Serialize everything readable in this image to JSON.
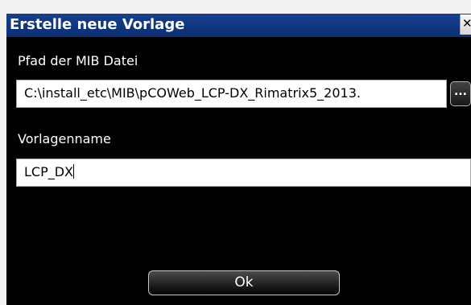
{
  "window": {
    "title": "Erstelle neue Vorlage",
    "close_icon": "close-icon",
    "close_glyph": "✕"
  },
  "form": {
    "mib_path": {
      "label": "Pfad der MIB Datei",
      "value": "C:\\install_etc\\MIB\\pCOWeb_LCP-DX_Rimatrix5_2013.",
      "browse_label": "..."
    },
    "template_name": {
      "label": "Vorlagenname",
      "value": "LCP_DX"
    }
  },
  "actions": {
    "ok_label": "Ok"
  },
  "colors": {
    "titlebar": "#0b2e72",
    "dialog_background": "#000000",
    "field_background": "#ffffff"
  }
}
